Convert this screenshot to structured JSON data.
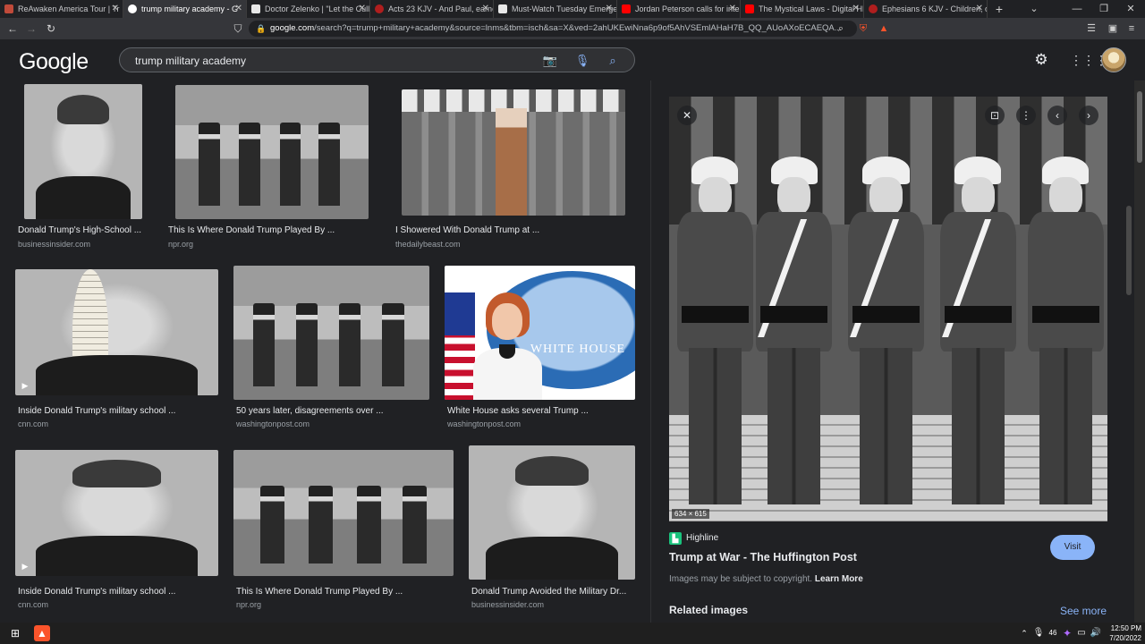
{
  "tabs": [
    {
      "title": "ReAwaken America Tour | Tr",
      "fav": "#c04a3a",
      "active": false
    },
    {
      "title": "trump military academy - G",
      "fav": "#ffffff",
      "active": true
    },
    {
      "title": "Doctor Zelenko | \"Let the Cullin",
      "fav": "#e8e8e8",
      "active": false
    },
    {
      "title": "Acts 23 KJV - And Paul, earnestl",
      "fav": "#b01e1e",
      "active": false
    },
    {
      "title": "Must-Watch Tuesday Emergenc",
      "fav": "#e8e8e8",
      "active": false
    },
    {
      "title": "Jordan Peterson calls for interfa",
      "fav": "#ff0000",
      "active": false
    },
    {
      "title": "The Mystical Laws - Digital HD",
      "fav": "#ff0000",
      "active": false
    },
    {
      "title": "Ephesians 6 KJV - Children, obe",
      "fav": "#b01e1e",
      "active": false
    }
  ],
  "new_tab": "+",
  "window_controls": {
    "minimize": "—",
    "restore": "❐",
    "close": "✕"
  },
  "address": {
    "host": "google.com",
    "path": "/search?q=trump+military+academy&source=lnms&tbm=isch&sa=X&ved=2ahUKEwiNna6p9of5AhVSEmlAHaH7B_QQ_AUoAXoECAEQA..."
  },
  "google": {
    "logo": "Google",
    "query": "trump military academy"
  },
  "results": [
    {
      "caption": "Donald Trump's High-School ...",
      "source": "businessinsider.com"
    },
    {
      "caption": "This Is Where Donald Trump Played By ...",
      "source": "npr.org"
    },
    {
      "caption": "I Showered With Donald Trump at ...",
      "source": "thedailybeast.com"
    },
    {
      "caption": "Inside Donald Trump's military school ...",
      "source": "cnn.com"
    },
    {
      "caption": "50 years later, disagreements over ...",
      "source": "washingtonpost.com"
    },
    {
      "caption": "White House asks several Trump ...",
      "source": "washingtonpost.com"
    },
    {
      "caption": "Inside Donald Trump's military school ...",
      "source": "cnn.com"
    },
    {
      "caption": "This Is Where Donald Trump Played By ...",
      "source": "npr.org"
    },
    {
      "caption": "Donald Trump Avoided the Military Dr...",
      "source": "businessinsider.com"
    }
  ],
  "white_house_text": "WHITE HOUSE",
  "preview": {
    "dimensions": "634 × 615",
    "source_name": "Highline",
    "title": "Trump at War - The Huffington Post",
    "visit_label": "Visit",
    "copyright": "Images may be subject to copyright.",
    "learn_more": "Learn More",
    "related": "Related images",
    "see_more": "See more"
  },
  "clock": {
    "time": "12:50 PM",
    "date": "7/20/2022"
  },
  "colors": {
    "accent": "#8ab4f8",
    "background": "#202124",
    "visit_bg": "#8ab4f8"
  }
}
